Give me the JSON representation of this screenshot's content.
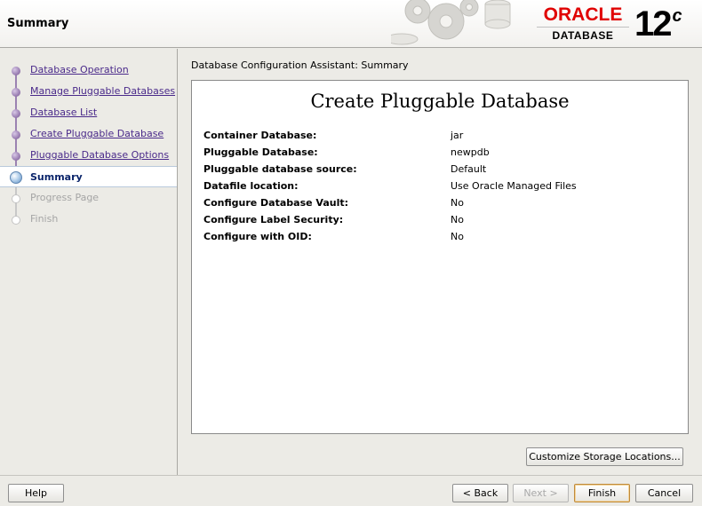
{
  "header": {
    "title": "Summary",
    "logo_word": "ORACLE",
    "logo_product": "DATABASE",
    "version_number": "12",
    "version_suffix": "c"
  },
  "nav": {
    "items": [
      {
        "label": "Database Operation",
        "state": "done"
      },
      {
        "label": "Manage Pluggable Databases",
        "state": "done"
      },
      {
        "label": "Database List",
        "state": "done"
      },
      {
        "label": "Create Pluggable Database",
        "state": "done"
      },
      {
        "label": "Pluggable Database Options",
        "state": "done"
      },
      {
        "label": "Summary",
        "state": "current"
      },
      {
        "label": "Progress Page",
        "state": "future"
      },
      {
        "label": "Finish",
        "state": "future"
      }
    ]
  },
  "main": {
    "caption": "Database Configuration Assistant: Summary",
    "panel_title": "Create Pluggable Database",
    "summary": [
      {
        "key": "Container Database:",
        "value": "jar"
      },
      {
        "key": "Pluggable Database:",
        "value": "newpdb"
      },
      {
        "key": "Pluggable database source:",
        "value": "Default"
      },
      {
        "key": "Datafile location:",
        "value": "Use Oracle Managed Files"
      },
      {
        "key": "Configure Database Vault:",
        "value": "No"
      },
      {
        "key": "Configure Label Security:",
        "value": "No"
      },
      {
        "key": "Configure with OID:",
        "value": "No"
      }
    ],
    "customize_button": "Customize Storage Locations..."
  },
  "footer": {
    "help": "Help",
    "back": "< Back",
    "next": "Next >",
    "finish": "Finish",
    "cancel": "Cancel"
  },
  "colors": {
    "link": "#4a2a8a",
    "current": "#0a246a",
    "oracle_red": "#e00000"
  }
}
